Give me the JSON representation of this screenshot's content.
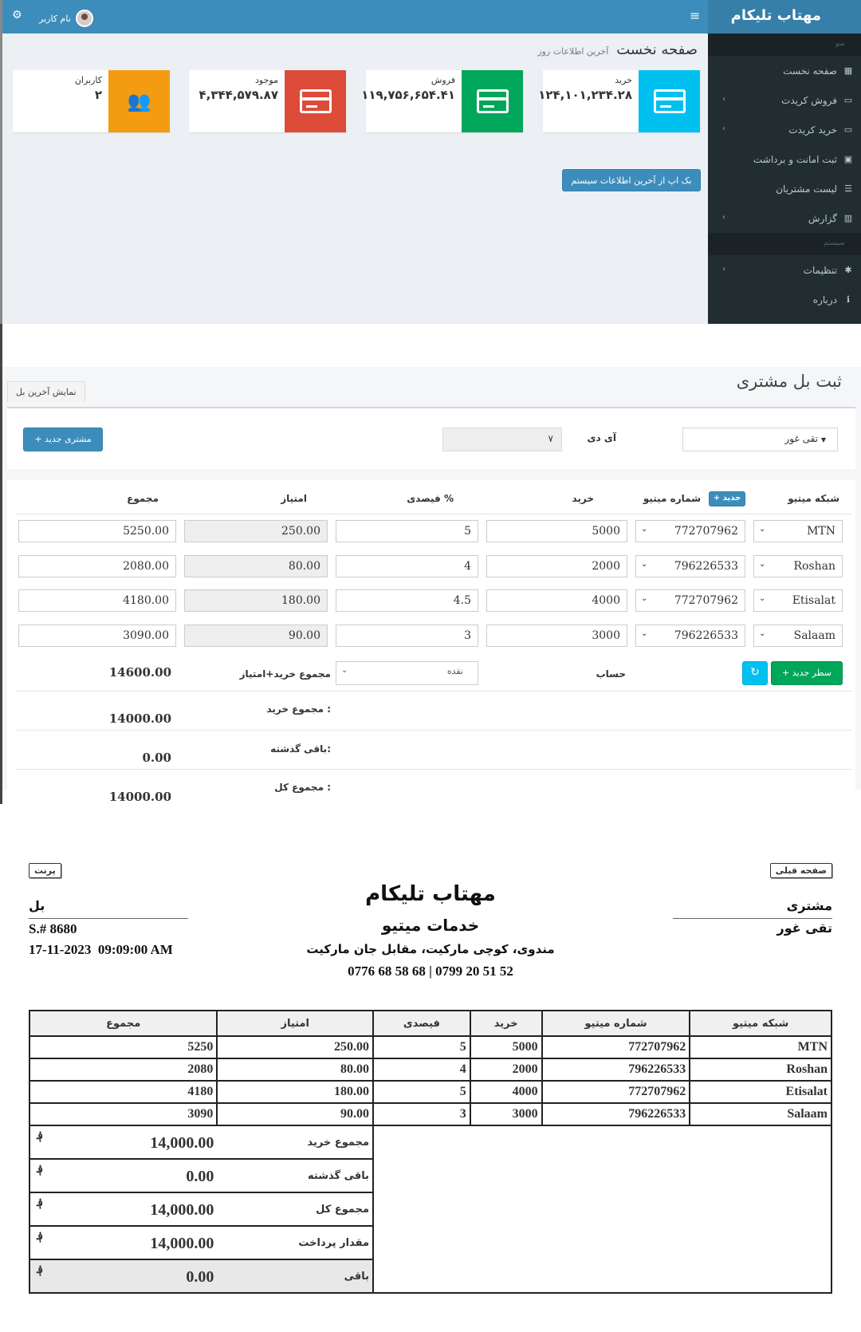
{
  "dashboard": {
    "brand": "مهتاب تلیکام",
    "user_name": "نام کاربر",
    "page_title": "صفحه نخست",
    "page_subtitle": "آخرین اطلاعات روز",
    "sidebar": {
      "menu_header": "منو",
      "system_header": "سیستم",
      "items": [
        {
          "label": "صفحه نخست",
          "icon": "dashboard-icon"
        },
        {
          "label": "فروش کریدت",
          "icon": "credit-card-icon"
        },
        {
          "label": "خرید کریدت",
          "icon": "credit-card-icon"
        },
        {
          "label": "ثبت امانت و برداشت",
          "icon": "money-icon"
        },
        {
          "label": "لیست مشتریان",
          "icon": "list-icon"
        },
        {
          "label": "گزارش",
          "icon": "bar-chart-icon"
        },
        {
          "label": "تنظیمات",
          "icon": "gear-icon"
        },
        {
          "label": "درباره",
          "icon": "info-icon"
        }
      ]
    },
    "info_boxes": [
      {
        "label": "خرید",
        "value": "۱۲۴,۱۰۱,۲۳۴.۲۸",
        "color": "#00c0ef"
      },
      {
        "label": "فروش",
        "value": "۱۱۹,۷۵۶,۶۵۴.۴۱",
        "color": "#00a65a"
      },
      {
        "label": "موجود",
        "value": "۴,۳۴۴,۵۷۹.۸۷",
        "color": "#dd4b39"
      },
      {
        "label": "کاربران",
        "value": "۲",
        "color": "#f39c12"
      }
    ],
    "backup_button": "بک اپ از آخرین اطلاعات سیستم"
  },
  "bill_form": {
    "title": "ثبت بل مشتری",
    "show_last_bill": "نمایش آخرین بل",
    "customer_selected": "تقی غور",
    "id_label": "آی دی",
    "id_value": "۷",
    "new_customer_button": "+ مشتری جدید",
    "columns": {
      "network": "شبکه میتیو",
      "number": "شماره میتیو",
      "new_badge": "+ جدید",
      "purchase": "خرید",
      "percent": "فیصدی %",
      "points": "امتیاز",
      "total": "مجموع"
    },
    "rows": [
      {
        "network": "MTN",
        "number": "772707962",
        "purchase": "5000",
        "percent": "5",
        "points": "250.00",
        "total": "5250.00"
      },
      {
        "network": "Roshan",
        "number": "796226533",
        "purchase": "2000",
        "percent": "4",
        "points": "80.00",
        "total": "2080.00"
      },
      {
        "network": "Etisalat",
        "number": "772707962",
        "purchase": "4000",
        "percent": "4.5",
        "points": "180.00",
        "total": "4180.00"
      },
      {
        "network": "Salaam",
        "number": "796226533",
        "purchase": "3000",
        "percent": "3",
        "points": "90.00",
        "total": "3090.00"
      }
    ],
    "new_row_button": "+ سطر جدید",
    "account_label": "حساب",
    "account_value": "نقده",
    "sum_purchase_points_label": "مجموع خرید+امتیاز",
    "sum_purchase_points_value": "14600.00",
    "sum_purchase_label": "مجموع خرید :",
    "sum_purchase_value": "14000.00",
    "previous_balance_label": "باقی گذشته:",
    "previous_balance_value": "0.00",
    "grand_total_label": "مجموع کل :",
    "grand_total_value": "14000.00"
  },
  "receipt": {
    "back_button": "صفحه قبلی",
    "print_button": "پرنت",
    "company": "مهتاب تلیکام",
    "service": "خدمات میتیو",
    "address": "مندوی، کوچی مارکیت، مقابل جان مارکیت",
    "phones": "0776 68 58 68  |  0799 20 51 52",
    "customer_label": "مشتری",
    "customer_name": "تقی غور",
    "bill_label": "بل",
    "serial": "S.# 8680",
    "datetime": "17-11-2023  09:09:00 AM",
    "columns": [
      "شبکه میتیو",
      "شماره میتیو",
      "خرید",
      "فیصدی",
      "امتیاز",
      "مجموع"
    ],
    "rows": [
      {
        "network": "MTN",
        "number": "772707962",
        "purchase": "5000",
        "percent": "5",
        "points": "250.00",
        "total": "5250"
      },
      {
        "network": "Roshan",
        "number": "796226533",
        "purchase": "2000",
        "percent": "4",
        "points": "80.00",
        "total": "2080"
      },
      {
        "network": "Etisalat",
        "number": "772707962",
        "purchase": "4000",
        "percent": "5",
        "points": "180.00",
        "total": "4180"
      },
      {
        "network": "Salaam",
        "number": "796226533",
        "purchase": "3000",
        "percent": "3",
        "points": "90.00",
        "total": "3090"
      }
    ],
    "currency": "؋",
    "summary": [
      {
        "label": "مجموع خرید",
        "value": "14,000.00"
      },
      {
        "label": "باقی گذشته",
        "value": "0.00"
      },
      {
        "label": "مجموع کل",
        "value": "14,000.00"
      },
      {
        "label": "مقدار پرداخت",
        "value": "14,000.00"
      },
      {
        "label": "باقی",
        "value": "0.00"
      }
    ]
  }
}
